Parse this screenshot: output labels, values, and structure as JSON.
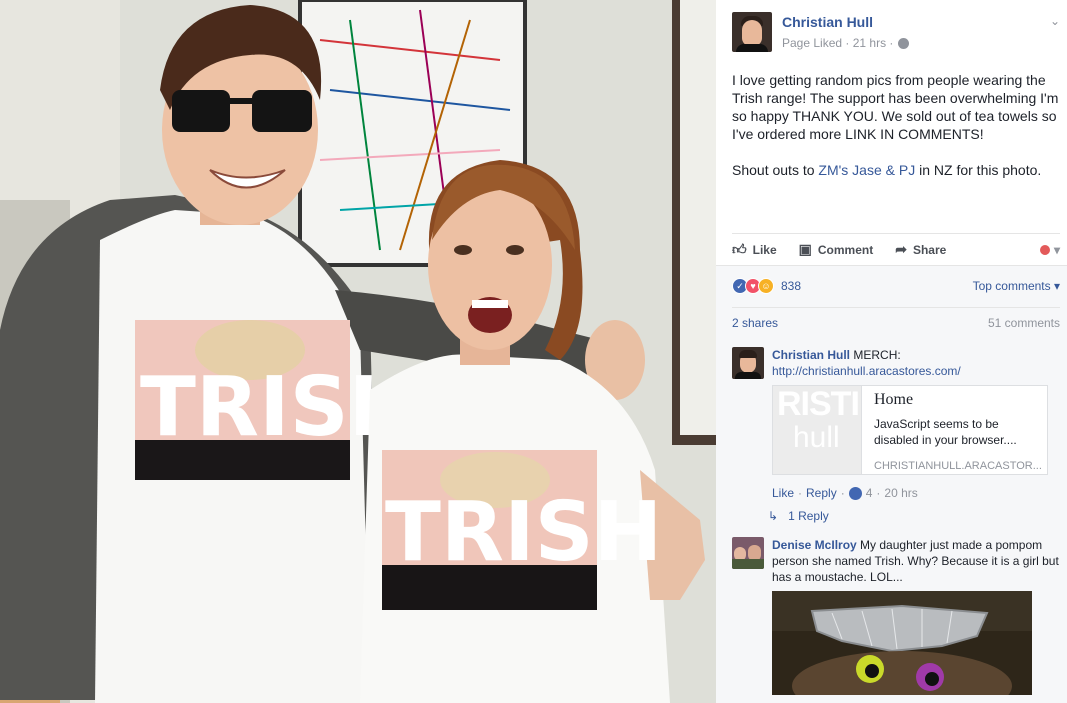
{
  "post": {
    "author": "Christian Hull",
    "meta": "Page Liked · 21 hrs ·",
    "text_p1": "I love getting random pics from people wearing the Trish range! The support has been overwhelming I'm so happy THANK YOU. We sold out of tea towels so I've ordered more LINK IN COMMENTS!",
    "text_p2_before": "Shout outs to ",
    "text_p2_link": "ZM's Jase & PJ",
    "text_p2_after": " in NZ for this photo."
  },
  "actions": {
    "like": "Like",
    "comment": "Comment",
    "share": "Share"
  },
  "reactions": {
    "count": "838",
    "top_comments": "Top comments",
    "shares": "2 shares",
    "comments": "51 comments"
  },
  "comments": [
    {
      "name": "Christian Hull",
      "text": "MERCH:",
      "link": "http://christianhull.aracastores.com/",
      "preview": {
        "thumb_line1": "RISTI",
        "thumb_line2": "hull",
        "title": "Home",
        "description": "JavaScript seems to be disabled in your browser....",
        "domain": "CHRISTIANHULL.ARACASTOR..."
      },
      "like": "Like",
      "reply": "Reply",
      "likes": "4",
      "time": "20 hrs",
      "replies": "1 Reply"
    },
    {
      "name": "Denise McIlroy",
      "text": "My daughter just made a pompom person she named Trish. Why? Because it is a girl but has a moustache. LOL..."
    }
  ],
  "shirt_text": "TRISH",
  "colors": {
    "link_blue": "#365899",
    "fb_blue": "#4267b2",
    "meta_gray": "#90949c"
  }
}
